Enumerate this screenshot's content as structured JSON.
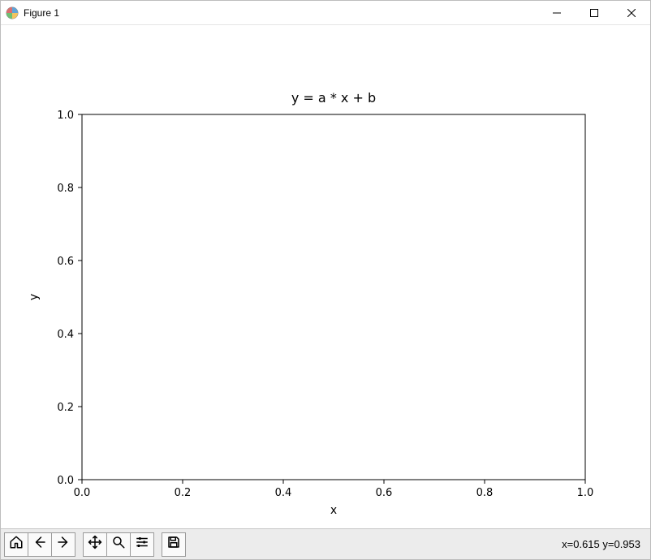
{
  "window": {
    "title": "Figure 1"
  },
  "chart_data": {
    "type": "line",
    "title": "y = a * x + b",
    "xlabel": "x",
    "ylabel": "y",
    "xlim": [
      0.0,
      1.0
    ],
    "ylim": [
      0.0,
      1.0
    ],
    "xticks": [
      0.0,
      0.2,
      0.4,
      0.6,
      0.8,
      1.0
    ],
    "yticks": [
      0.0,
      0.2,
      0.4,
      0.6,
      0.8,
      1.0
    ],
    "series": []
  },
  "ticks": {
    "x": {
      "0": "0.0",
      "1": "0.2",
      "2": "0.4",
      "3": "0.6",
      "4": "0.8",
      "5": "1.0"
    },
    "y": {
      "0": "0.0",
      "1": "0.2",
      "2": "0.4",
      "3": "0.6",
      "4": "0.8",
      "5": "1.0"
    }
  },
  "toolbar": {
    "home": "Home",
    "back": "Back",
    "forward": "Forward",
    "pan": "Pan",
    "zoom": "Zoom",
    "configure": "Configure subplots",
    "save": "Save"
  },
  "status": {
    "coords": "x=0.615 y=0.953"
  }
}
